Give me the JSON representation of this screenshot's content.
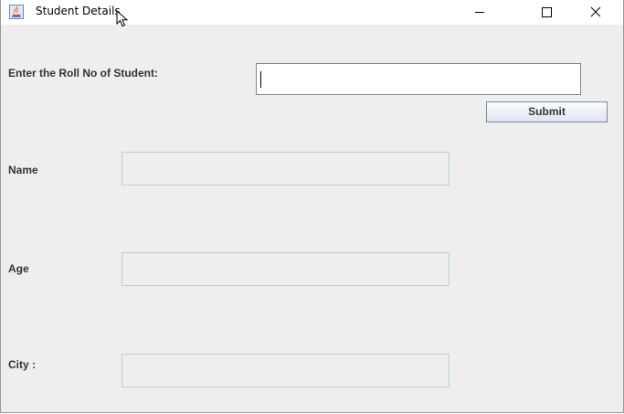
{
  "window": {
    "title": "Student Details",
    "icons": {
      "app": "java-app-icon",
      "minimize": "minimize-icon",
      "maximize": "maximize-icon",
      "close": "close-icon",
      "pointer": "mouse-pointer-icon"
    }
  },
  "form": {
    "roll_label": "Enter the Roll No of Student:",
    "roll_value": "",
    "submit_label": "Submit",
    "name_label": "Name",
    "name_value": "",
    "age_label": "Age",
    "age_value": "",
    "city_label": "City :",
    "city_value": ""
  },
  "colors": {
    "window_bg": "#eeeeee",
    "titlebar_bg": "#ffffff",
    "field_border": "#b9cde0",
    "input_border": "#7a8a99"
  }
}
